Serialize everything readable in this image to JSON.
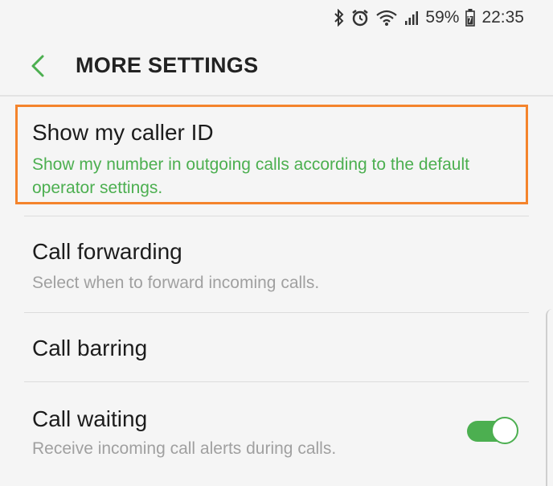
{
  "status_bar": {
    "battery": "59%",
    "time": "22:35",
    "icons": [
      "bluetooth-icon",
      "alarm-icon",
      "wifi-icon",
      "signal-icon",
      "battery-icon"
    ]
  },
  "header": {
    "title": "MORE SETTINGS",
    "back_icon": "chevron-left-icon"
  },
  "settings": [
    {
      "title": "Show my caller ID",
      "summary": "Show my number in outgoing calls according to the default operator settings.",
      "summary_color": "#4caf50",
      "highlighted": true
    },
    {
      "title": "Call forwarding",
      "summary": "Select when to forward incoming calls.",
      "summary_color": "#a0a0a0"
    },
    {
      "title": "Call barring"
    },
    {
      "title": "Call waiting",
      "summary": "Receive incoming call alerts during calls.",
      "summary_color": "#a0a0a0",
      "toggle": "on"
    }
  ],
  "colors": {
    "accent": "#4caf50",
    "highlight_border": "#f4842c",
    "background": "#f5f5f5"
  }
}
